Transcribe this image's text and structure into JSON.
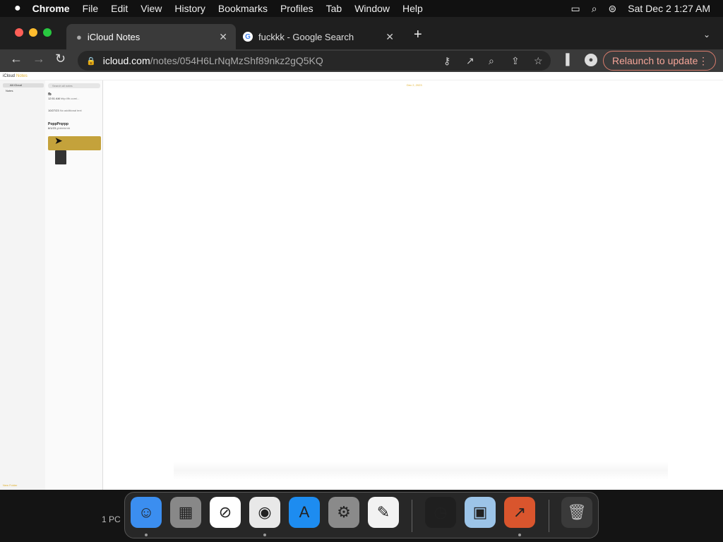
{
  "menubar": {
    "apple": "",
    "app": "Chrome",
    "items": [
      "File",
      "Edit",
      "View",
      "History",
      "Bookmarks",
      "Profiles",
      "Tab",
      "Window",
      "Help"
    ],
    "clock": "Sat Dec 2  1:27 AM"
  },
  "tabs": [
    {
      "title": "iCloud Notes"
    },
    {
      "title": "fuckkk - Google Search"
    }
  ],
  "omnibox": {
    "host": "icloud.com",
    "path": "/notes/054H6LrNqMzShf89nkz2gQ5KQ"
  },
  "relaunch_label": "Relaunch to update",
  "notes": {
    "brand": "iCloud",
    "app": "Notes",
    "folder": "All iCloud",
    "subfolder": "Notes",
    "search_placeholder": "Search all notes",
    "list": [
      {
        "title": "fb",
        "time": "12:51 AM",
        "snippet": "http://fb.com/..."
      },
      {
        "title": "",
        "time": "10/27/23",
        "snippet": "No additional text"
      },
      {
        "title": "PoppPrqrpp",
        "time": "8/1/23",
        "snippet": "ghbhhkhfd"
      }
    ],
    "editor_date": "Dec 2, 2023",
    "sidebar_bottom": "New Folder"
  },
  "desktop": {
    "label": "1 PC"
  },
  "dock": [
    {
      "name": "finder",
      "glyph": "☺",
      "bg": "#3b8ef0",
      "running": true
    },
    {
      "name": "launchpad",
      "glyph": "▦",
      "bg": "#888888",
      "running": false
    },
    {
      "name": "safari",
      "glyph": "⊘",
      "bg": "#ffffff",
      "running": false
    },
    {
      "name": "chrome",
      "glyph": "◉",
      "bg": "#e8e8e8",
      "running": true
    },
    {
      "name": "app-store",
      "glyph": "A",
      "bg": "#1d8cf0",
      "running": false
    },
    {
      "name": "system-settings",
      "glyph": "⚙",
      "bg": "#8a8a8a",
      "running": false
    },
    {
      "name": "textedit",
      "glyph": "✎",
      "bg": "#f2f2f2",
      "running": false
    },
    {
      "name": "clock",
      "glyph": "◷",
      "bg": "#1f1f1f",
      "running": false
    },
    {
      "name": "preview",
      "glyph": "▣",
      "bg": "#9cc4e8",
      "running": false
    },
    {
      "name": "remote-desktop",
      "glyph": "↗",
      "bg": "#d9552d",
      "running": true
    },
    {
      "name": "trash",
      "glyph": "🗑",
      "bg": "#3a3a3a",
      "running": false
    }
  ]
}
